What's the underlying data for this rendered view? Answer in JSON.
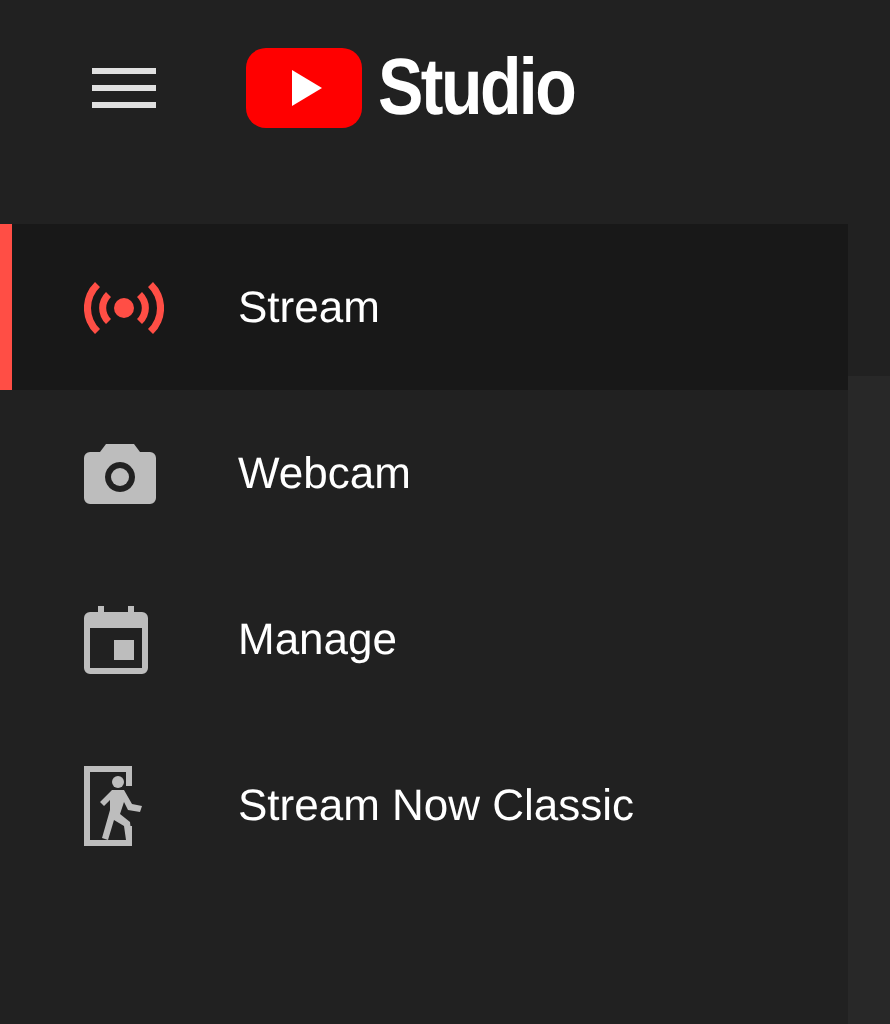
{
  "header": {
    "brand": "Studio"
  },
  "nav": [
    {
      "label": "Stream",
      "selected": true
    },
    {
      "label": "Webcam",
      "selected": false
    },
    {
      "label": "Manage",
      "selected": false
    },
    {
      "label": "Stream Now Classic",
      "selected": false
    }
  ]
}
